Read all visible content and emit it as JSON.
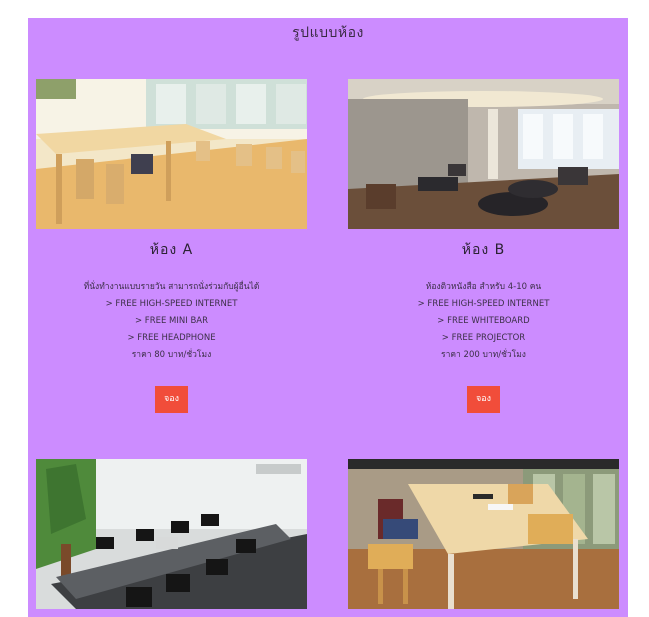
{
  "section_title": "รูปแบบห้อง",
  "rooms": [
    {
      "title": "ห้อง A",
      "description": "ที่นั่งทำงานแบบรายวัน สามารถนั่งร่วมกับผู้อื่นได้",
      "features": [
        "> FREE HIGH-SPEED INTERNET",
        "> FREE MINI BAR",
        "> FREE HEADPHONE"
      ],
      "price": "ราคา 80 บาท/ชั่วโมง",
      "book_label": "จอง"
    },
    {
      "title": "ห้อง B",
      "description": "ห้องติวหนังสือ สำหรับ 4-10 คน",
      "features": [
        "> FREE HIGH-SPEED INTERNET",
        "> FREE WHITEBOARD",
        "> FREE PROJECTOR"
      ],
      "price": "ราคา 200 บาท/ชั่วโมง",
      "book_label": "จอง"
    }
  ],
  "colors": {
    "panel_background": "#cc8cff",
    "book_button": "#f14d3a"
  }
}
